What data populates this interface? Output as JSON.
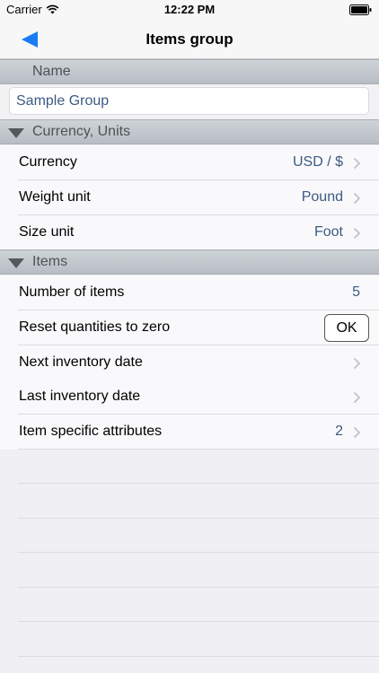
{
  "status_bar": {
    "carrier": "Carrier",
    "time": "12:22 PM"
  },
  "nav": {
    "title": "Items group"
  },
  "name_section": {
    "header": "Name",
    "value": "Sample Group"
  },
  "currency_section": {
    "header": "Currency, Units",
    "rows": [
      {
        "label": "Currency",
        "value": "USD / $"
      },
      {
        "label": "Weight unit",
        "value": "Pound"
      },
      {
        "label": "Size unit",
        "value": "Foot"
      }
    ]
  },
  "items_section": {
    "header": "Items",
    "number_of_items": {
      "label": "Number of items",
      "value": "5"
    },
    "reset": {
      "label": "Reset quantities to zero",
      "button": "OK"
    },
    "next_inventory": {
      "label": "Next inventory date"
    },
    "last_inventory": {
      "label": "Last inventory date"
    },
    "specific_attributes": {
      "label": "Item specific attributes",
      "value": "2"
    }
  },
  "colors": {
    "accent": "#1a7cf4",
    "value_text": "#3c5a82",
    "section_header": "#bfc5cb"
  }
}
